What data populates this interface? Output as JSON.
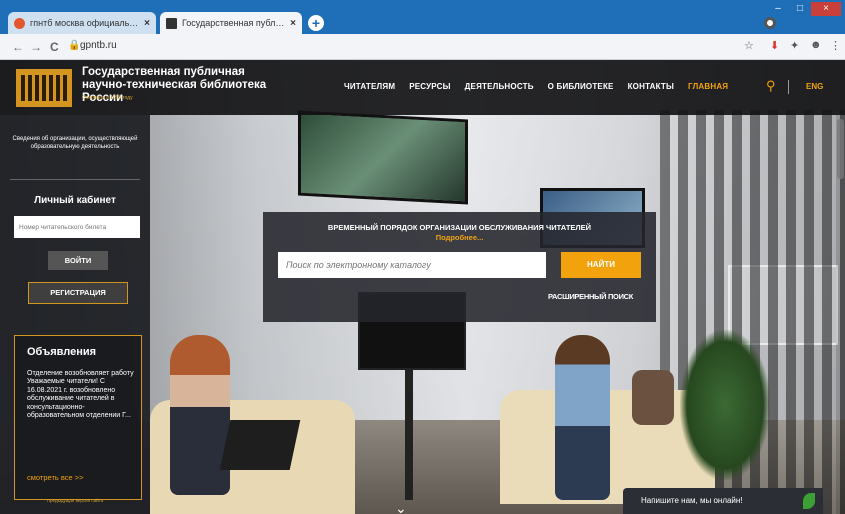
{
  "browser": {
    "tabs": [
      {
        "title": "гпнтб москва официальный са",
        "favicon_color": "#e4572e",
        "close": "×"
      },
      {
        "title": "Государственная публичная на",
        "favicon_color": "#333333",
        "close": "×"
      }
    ],
    "new_tab": "+",
    "url": "gpntb.ru",
    "nav": {
      "back": "←",
      "forward": "→",
      "reload": "C",
      "lock": "🔒"
    },
    "toolbar_icons": {
      "star": "☆",
      "ext1": "⬇",
      "ext2": "✦",
      "profile": "☻",
      "menu": "⋮"
    },
    "window": {
      "minimize": "–",
      "maximize": "□",
      "close": "×"
    }
  },
  "header": {
    "title_line1": "Государственная публичная",
    "title_line2": "научно-техническая библиотека России",
    "subtitle": "Основана в 1958 году",
    "menu": [
      "ЧИТАТЕЛЯМ",
      "РЕСУРСЫ",
      "ДЕЯТЕЛЬНОСТЬ",
      "О БИБЛИОТЕКЕ",
      "КОНТАКТЫ",
      "ГЛАВНАЯ"
    ],
    "active_menu": "ГЛАВНАЯ",
    "lang": "ENG",
    "accent": "#f2a20d"
  },
  "sidebar": {
    "info_link": "Сведения об организации, осуществляющей образовательную деятельность",
    "cabinet_title": "Личный кабинет",
    "ticket_placeholder": "Номер читательского билета",
    "login_button": "ВОЙТИ",
    "register_button": "РЕГИСТРАЦИЯ",
    "announcements": {
      "title": "Объявления",
      "text": "Отделение возобновляет работу Уважаемые читатели! С 16.08.2021 г. возобновлено обслуживание читателей в консультационно-образовательном отделении Г...",
      "link": "смотреть все >>"
    },
    "old_version": "Предыдущая версия сайта"
  },
  "main": {
    "notice": "ВРЕМЕННЫЙ ПОРЯДОК ОРГАНИЗАЦИИ ОБСЛУЖИВАНИЯ ЧИТАТЕЛЕЙ",
    "more_link": "Подробнее...",
    "catalog_placeholder": "Поиск по электронному каталогу",
    "find_button": "НАЙТИ",
    "advanced_search": "РАСШИРЕННЫЙ ПОИСК",
    "scroll_down": "⌄"
  },
  "chat": {
    "text": "Напишите нам, мы онлайн!"
  }
}
